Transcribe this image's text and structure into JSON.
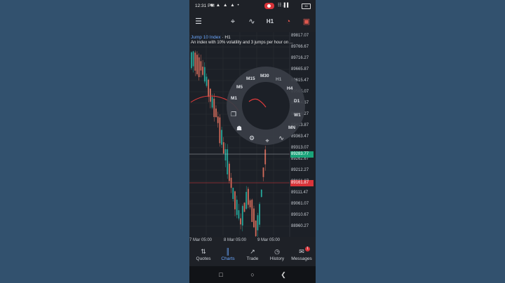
{
  "status": {
    "time": "12:31 PM",
    "left_icons": "■ ▲ ▲ ▲ •",
    "right_text": "☷ .▌▌",
    "battery": "30"
  },
  "toolbar": {
    "menu_icon": "☰",
    "crosshair_icon": "⌖",
    "indicators_icon": "∿",
    "timeframe": "H1",
    "objects_icon": "◔",
    "trade_icon": "▣"
  },
  "chart": {
    "symbol": "Jump 10 Index",
    "separator": " · ",
    "timeframe": "H1",
    "description": "An index with 10% volatility and 3 jumps per hour on ..."
  },
  "price_axis": {
    "labels": [
      "89817.07",
      "89766.67",
      "89716.27",
      "89665.87",
      "89615.47",
      "89565.07",
      "89514.67",
      "89464.27",
      "89413.87",
      "89363.47",
      "89313.07",
      "89262.67",
      "89212.27",
      "89161.87",
      "89111.47",
      "89061.07",
      "89010.67",
      "88960.27"
    ],
    "bid_tag": "89283.77",
    "bid_color": "#1aa37a",
    "ask_tag": "89161.87",
    "ask_color": "#d8343a"
  },
  "time_axis": {
    "labels": [
      "7 Mar 05:00",
      "8 Mar 05:00",
      "9 Mar 05:00"
    ]
  },
  "timeframe_wheel": {
    "options": [
      "M1",
      "M5",
      "M15",
      "M30",
      "H1",
      "H4",
      "D1",
      "W1",
      "MN"
    ],
    "selected": "H1",
    "left_icons": [
      "❐",
      "☗"
    ],
    "bottom_icons": [
      "⚙",
      "⌖",
      "∿"
    ]
  },
  "bottom_nav": {
    "items": [
      {
        "label": "Quotes",
        "icon": "⇅",
        "active": false
      },
      {
        "label": "Charts",
        "icon": "║",
        "active": true
      },
      {
        "label": "Trade",
        "icon": "↗",
        "active": false
      },
      {
        "label": "History",
        "icon": "◷",
        "active": false
      },
      {
        "label": "Messages",
        "icon": "✉",
        "active": false,
        "badge": "1"
      }
    ]
  },
  "system_nav": {
    "recent": "□",
    "home": "○",
    "back": "❮"
  },
  "colors": {
    "active": "#6aa7ff",
    "bull": "#26a69a",
    "bear": "#d36b5a",
    "ma_line": "#e23b3b"
  }
}
